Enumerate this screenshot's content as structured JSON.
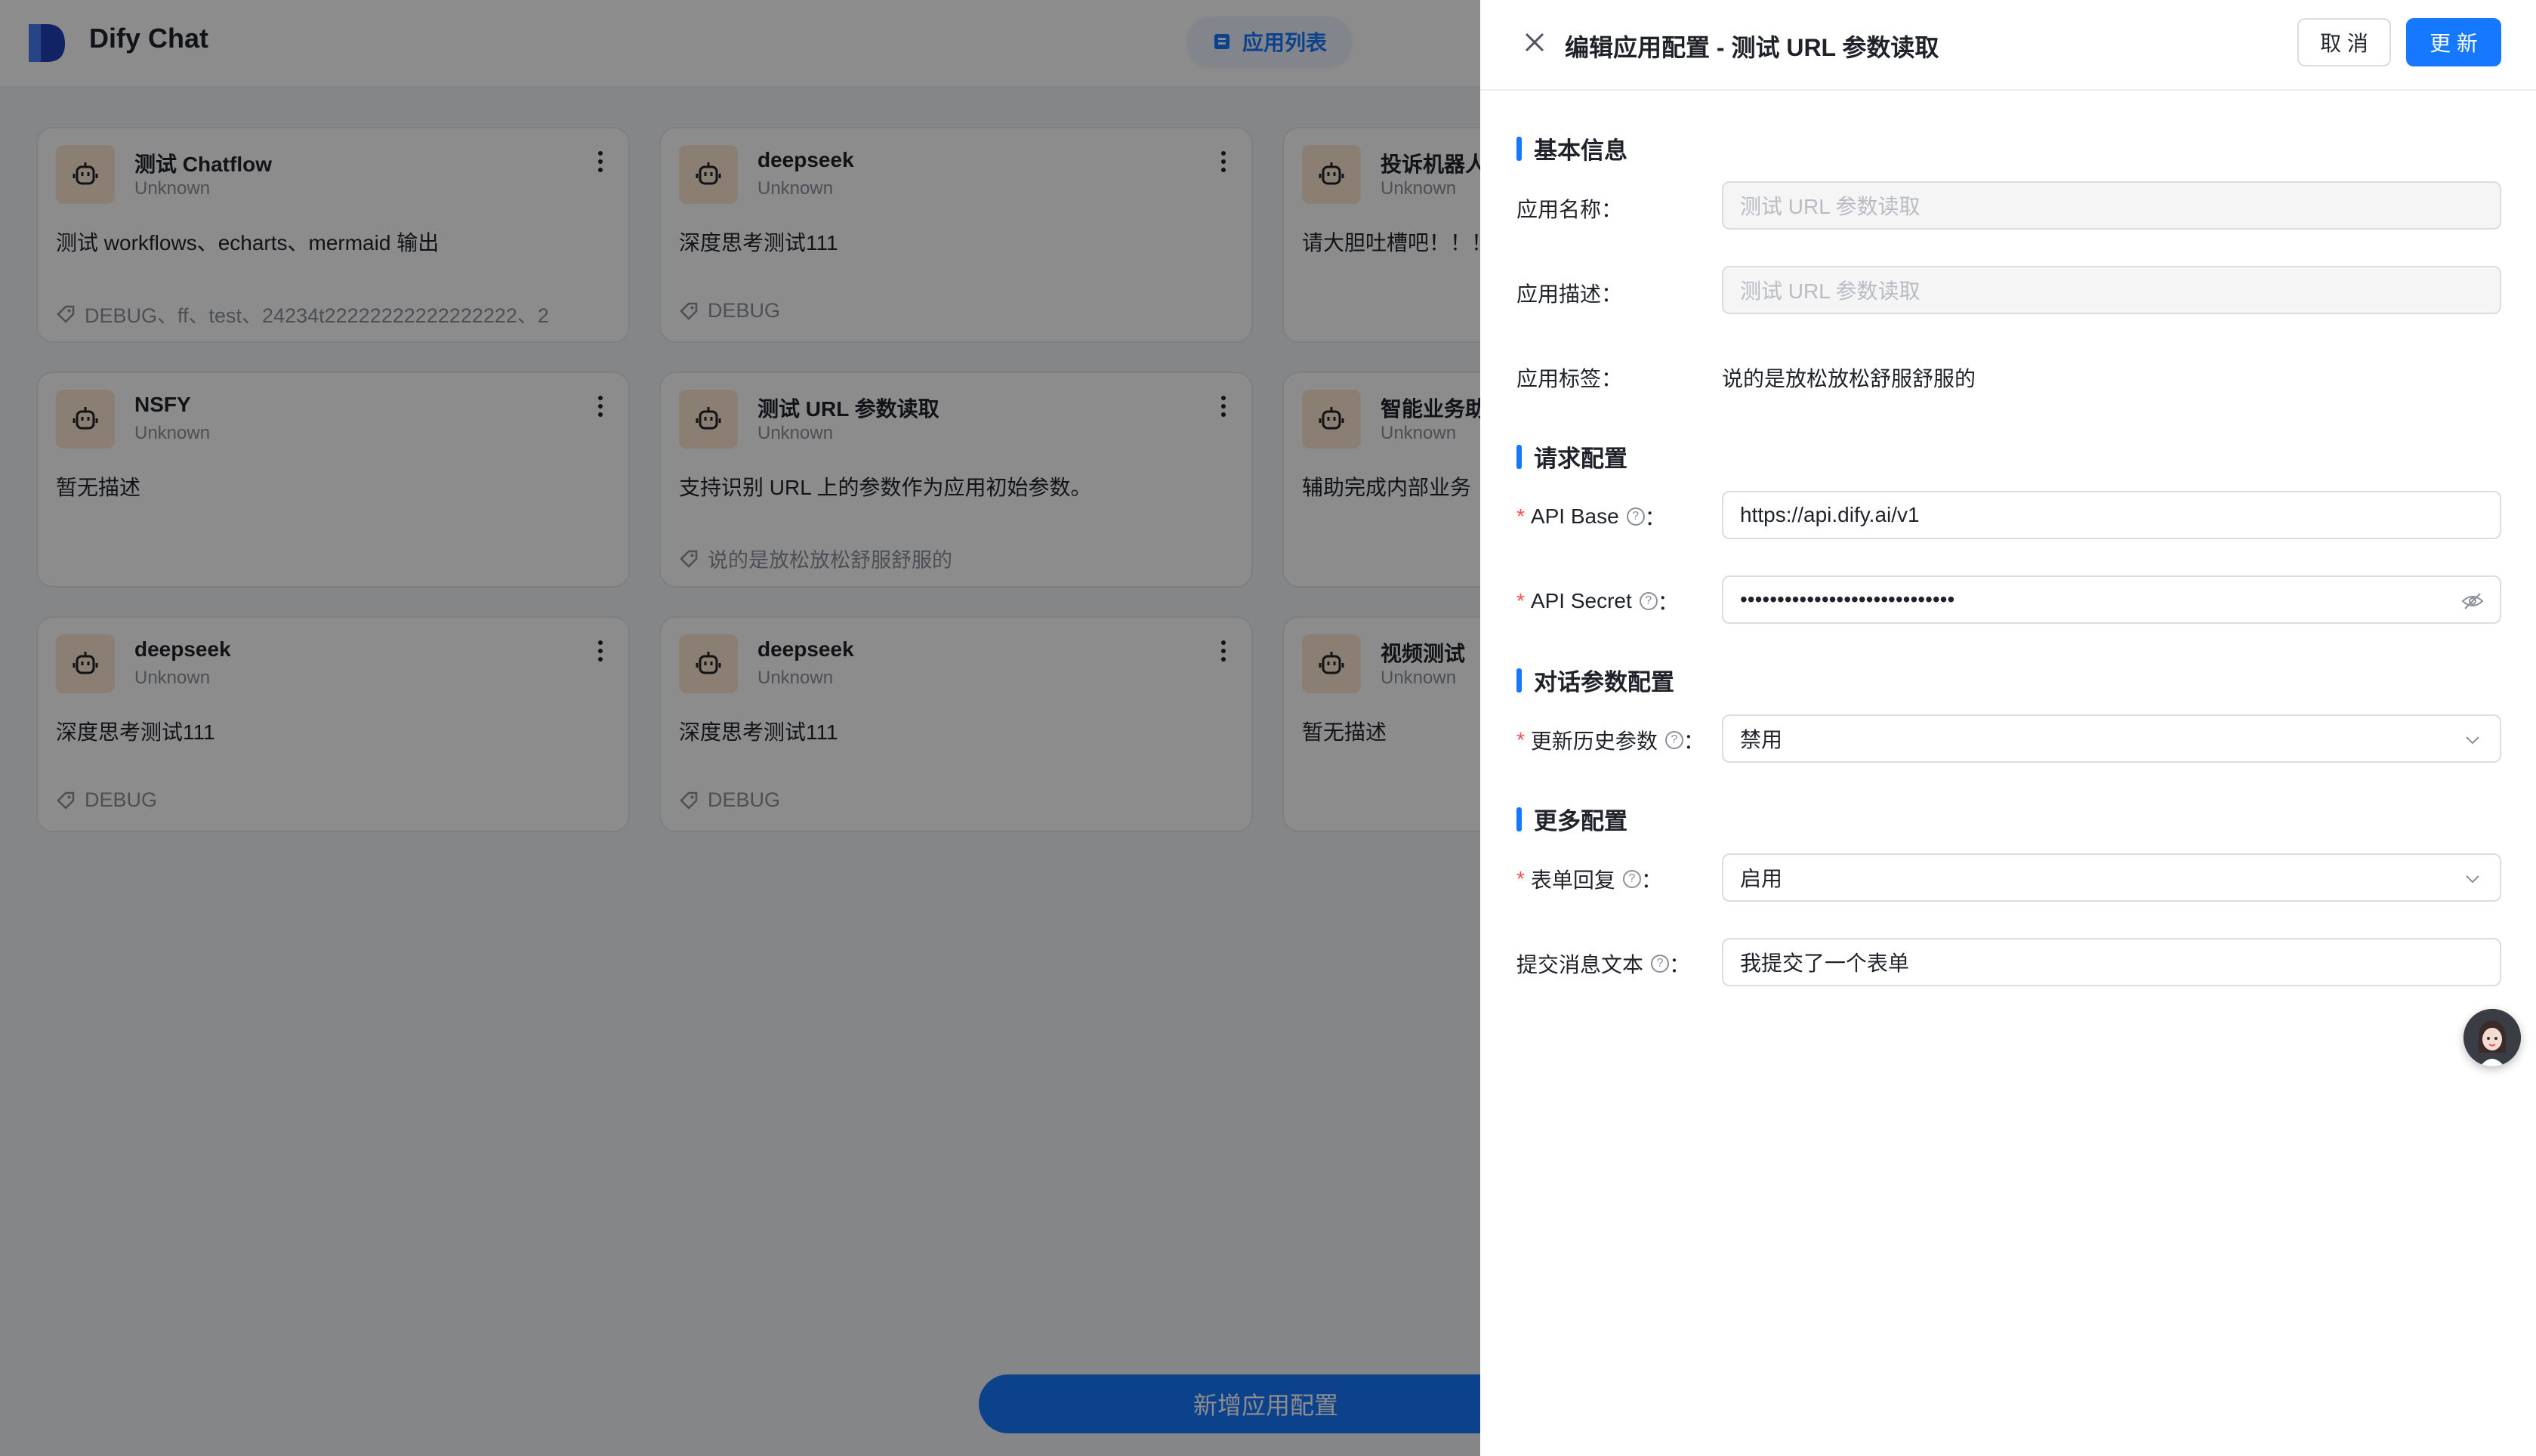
{
  "header": {
    "brand": "Dify Chat",
    "nav_label": "应用列表"
  },
  "cards": [
    {
      "name": "测试 Chatflow",
      "sub": "Unknown",
      "desc": "测试 workflows、echarts、mermaid 输出",
      "tags": "DEBUG、ff、test、24234t22222222222222222、2"
    },
    {
      "name": "deepseek",
      "sub": "Unknown",
      "desc": "深度思考测试111",
      "tags": "DEBUG"
    },
    {
      "name": "投诉机器人",
      "sub": "Unknown",
      "desc": "请大胆吐槽吧！！！",
      "tags": ""
    },
    {
      "name": "NSFY",
      "sub": "Unknown",
      "desc": "暂无描述",
      "tags": ""
    },
    {
      "name": "测试 URL 参数读取",
      "sub": "Unknown",
      "desc": "支持识别 URL 上的参数作为应用初始参数。",
      "tags": "说的是放松放松舒服舒服的"
    },
    {
      "name": "智能业务助手",
      "sub": "Unknown",
      "desc": "辅助完成内部业务",
      "tags": ""
    },
    {
      "name": "deepseek",
      "sub": "Unknown",
      "desc": "深度思考测试111",
      "tags": "DEBUG"
    },
    {
      "name": "deepseek",
      "sub": "Unknown",
      "desc": "深度思考测试111",
      "tags": "DEBUG"
    },
    {
      "name": "视频测试",
      "sub": "Unknown",
      "desc": "暂无描述",
      "tags": ""
    }
  ],
  "add_button": "新增应用配置",
  "drawer": {
    "title": "编辑应用配置 - 测试 URL 参数读取",
    "cancel": "取 消",
    "update": "更 新",
    "sections": {
      "basic": "基本信息",
      "request": "请求配置",
      "dialog": "对话参数配置",
      "more": "更多配置"
    },
    "fields": {
      "app_name_label": "应用名称",
      "app_name_value": "测试 URL 参数读取",
      "app_desc_label": "应用描述",
      "app_desc_value": "测试 URL 参数读取",
      "app_tags_label": "应用标签",
      "app_tags_value": "说的是放松放松舒服舒服的",
      "api_base_label": "API Base",
      "api_base_value": "https://api.dify.ai/v1",
      "api_secret_label": "API Secret",
      "api_secret_value": "•••••••••••••••••••••••••••••",
      "history_label": "更新历史参数",
      "history_value": "禁用",
      "form_reply_label": "表单回复",
      "form_reply_value": "启用",
      "submit_text_label": "提交消息文本",
      "submit_text_value": "我提交了一个表单"
    },
    "colon": "："
  },
  "colors": {
    "primary": "#1677ff",
    "required": "#ff4d4f"
  }
}
